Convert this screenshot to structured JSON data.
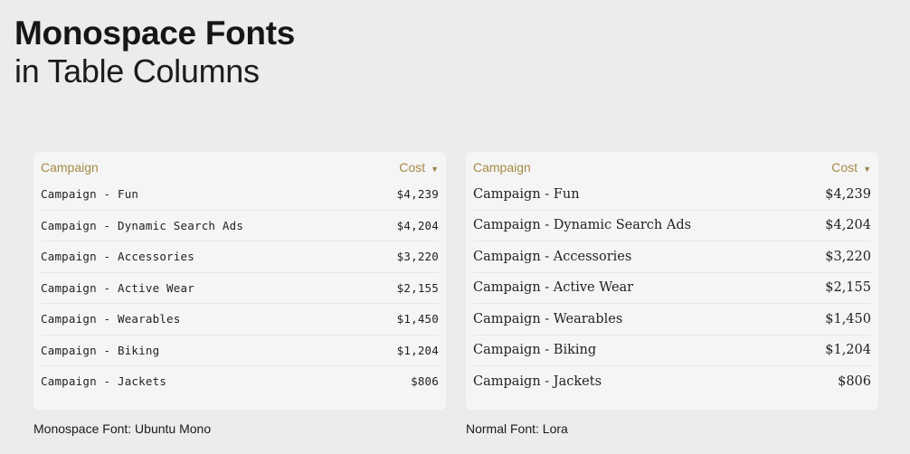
{
  "title": {
    "line1": "Monospace Fonts",
    "line2": "in Table Columns"
  },
  "header": {
    "campaign": "Campaign",
    "cost": "Cost",
    "sort_icon": "sort-desc-icon"
  },
  "rows": [
    {
      "name": "Campaign - Fun",
      "cost": "$4,239"
    },
    {
      "name": "Campaign - Dynamic Search Ads",
      "cost": "$4,204"
    },
    {
      "name": "Campaign - Accessories",
      "cost": "$3,220"
    },
    {
      "name": "Campaign - Active Wear",
      "cost": "$2,155"
    },
    {
      "name": "Campaign - Wearables",
      "cost": "$1,450"
    },
    {
      "name": "Campaign - Biking",
      "cost": "$1,204"
    },
    {
      "name": "Campaign - Jackets",
      "cost": "$806"
    }
  ],
  "captions": {
    "left": "Monospace Font: Ubuntu Mono",
    "right": "Normal Font: Lora"
  },
  "colors": {
    "background": "#ececec",
    "card": "#f5f5f5",
    "header_text": "#a68a45"
  }
}
